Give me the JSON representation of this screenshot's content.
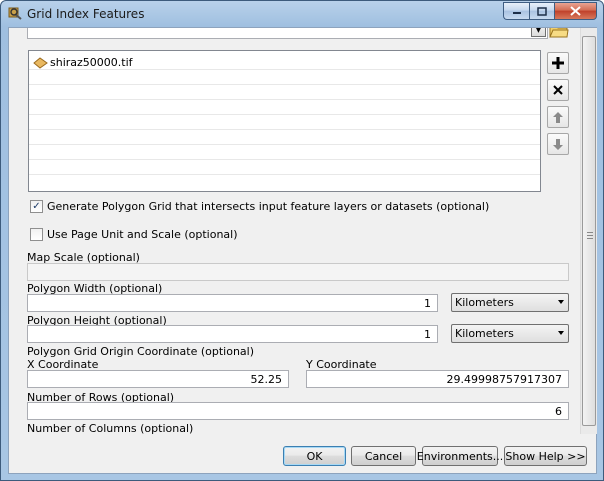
{
  "window": {
    "title": "Grid Index Features"
  },
  "list": {
    "items": [
      "shiraz50000.tif"
    ]
  },
  "options": {
    "generate_polygon_grid": {
      "label": "Generate Polygon Grid that intersects input feature layers or datasets (optional)",
      "checked": true
    },
    "use_page_unit": {
      "label": "Use Page Unit and Scale (optional)",
      "checked": false
    }
  },
  "fields": {
    "map_scale": {
      "label": "Map Scale (optional)",
      "value": ""
    },
    "polygon_width": {
      "label": "Polygon Width (optional)",
      "value": "1",
      "unit": "Kilometers"
    },
    "polygon_height": {
      "label": "Polygon Height (optional)",
      "value": "1",
      "unit": "Kilometers"
    },
    "origin": {
      "label": "Polygon Grid Origin Coordinate (optional)"
    },
    "x_coord": {
      "label": "X Coordinate",
      "value": "52.25"
    },
    "y_coord": {
      "label": "Y Coordinate",
      "value": "29.49998757917307"
    },
    "rows": {
      "label": "Number of Rows (optional)",
      "value": "6"
    },
    "columns": {
      "label": "Number of Columns (optional)"
    }
  },
  "buttons": {
    "ok": "OK",
    "cancel": "Cancel",
    "environments": "Environments...",
    "show_help": "Show Help >>"
  },
  "icons": {
    "app": "tool-icon",
    "folder": "open-folder-icon",
    "add": "plus-icon",
    "remove": "close-icon",
    "up": "arrow-up-icon",
    "down": "arrow-down-icon",
    "raster": "raster-layer-icon"
  }
}
